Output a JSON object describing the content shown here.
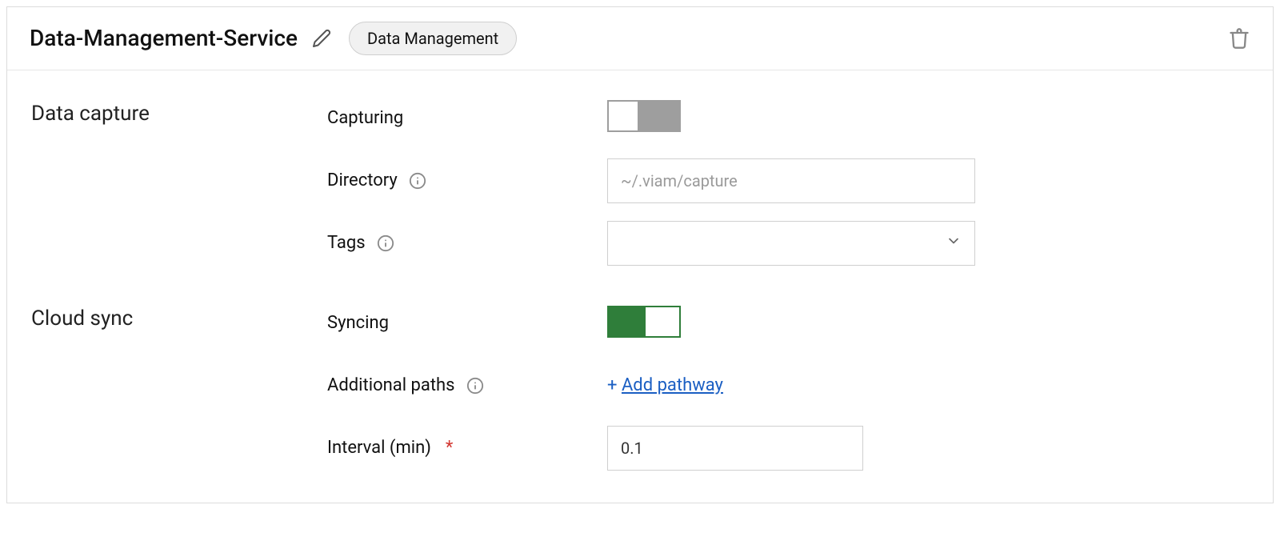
{
  "header": {
    "service_name": "Data-Management-Service",
    "badge": "Data Management"
  },
  "data_capture": {
    "section_title": "Data capture",
    "capturing_label": "Capturing",
    "capturing_on": false,
    "directory_label": "Directory",
    "directory_placeholder": "~/.viam/capture",
    "directory_value": "",
    "tags_label": "Tags"
  },
  "cloud_sync": {
    "section_title": "Cloud sync",
    "syncing_label": "Syncing",
    "syncing_on": true,
    "additional_paths_label": "Additional paths",
    "add_pathway_prefix": "+ ",
    "add_pathway_text": "Add pathway",
    "interval_label": "Interval (min)",
    "interval_value": "0.1"
  },
  "colors": {
    "toggle_on": "#2f7e3a",
    "toggle_off": "#9e9e9e",
    "link": "#1b5fc3"
  }
}
